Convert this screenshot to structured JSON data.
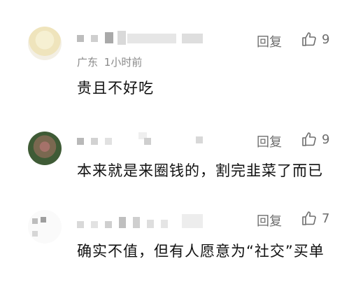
{
  "comments": [
    {
      "location": "广东",
      "time": "1小时前",
      "text": "贵且不好吃",
      "reply_label": "回复",
      "likes": "9"
    },
    {
      "text": "本来就是来圈钱的，割完韭菜了而已",
      "reply_label": "回复",
      "likes": "9"
    },
    {
      "text": "确实不值，但有人愿意为“社交”买单",
      "reply_label": "回复",
      "likes": "7"
    }
  ],
  "icons": {
    "like": "thumbs-up-icon"
  },
  "colors": {
    "text": "#111111",
    "secondary": "#8a8a8a",
    "action": "#6e6e6e"
  }
}
